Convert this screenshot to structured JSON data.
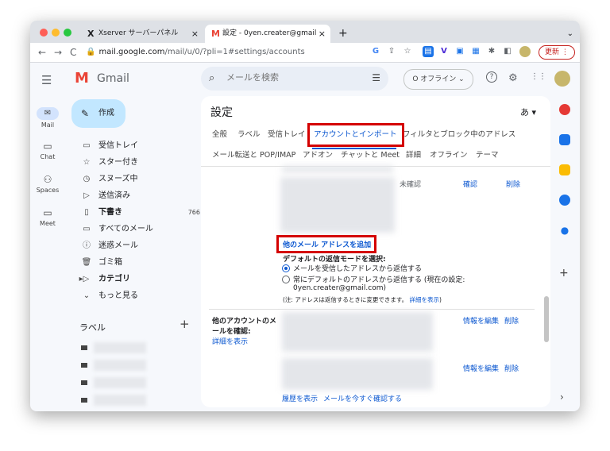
{
  "browser": {
    "tab_inactive": {
      "icon": "X",
      "title": "Xserver サーバーパネル",
      "close": "×"
    },
    "tab_active": {
      "icon": "M",
      "title": "設定 - 0yen.creater@gmail.com",
      "close": "×"
    },
    "new_tab": "+",
    "tab_menu": "⌄",
    "back": "←",
    "forward": "→",
    "reload": "C",
    "url_host": "mail.google.com",
    "url_path": "/mail/u/0/?pli=1#settings/accounts",
    "lock": "🔒",
    "update_label": "更新"
  },
  "gmail": {
    "menu_icon": "☰",
    "logo_mark": "M",
    "logo_text": "Gmail",
    "search_icon": "⌕",
    "search_placeholder": "メールを検索",
    "search_filter_icon": "☰",
    "status_label": "O オフライン ⌄",
    "help_icon": "?",
    "settings_icon": "⚙",
    "apps_icon": "⋮⋮"
  },
  "rail": [
    {
      "icon": "✉",
      "label": "Mail"
    },
    {
      "icon": "▭",
      "label": "Chat"
    },
    {
      "icon": "⚇",
      "label": "Spaces"
    },
    {
      "icon": "▭",
      "label": "Meet"
    }
  ],
  "compose": {
    "icon": "✎",
    "label": "作成"
  },
  "nav": [
    {
      "icon": "▭",
      "label": "受信トレイ",
      "count": "",
      "bold": false
    },
    {
      "icon": "☆",
      "label": "スター付き",
      "count": "",
      "bold": false
    },
    {
      "icon": "◷",
      "label": "スヌーズ中",
      "count": "",
      "bold": false
    },
    {
      "icon": "▷",
      "label": "送信済み",
      "count": "",
      "bold": false
    },
    {
      "icon": "▯",
      "label": "下書き",
      "count": "766",
      "bold": true
    },
    {
      "icon": "▭",
      "label": "すべてのメール",
      "count": "",
      "bold": false
    },
    {
      "icon": "ⓘ",
      "label": "迷惑メール",
      "count": "",
      "bold": false
    },
    {
      "icon": "🗑",
      "label": "ゴミ箱",
      "count": "",
      "bold": false
    },
    {
      "icon": "▸▷",
      "label": "カテゴリ",
      "count": "",
      "bold": true
    },
    {
      "icon": "⌄",
      "label": "もっと見る",
      "count": "",
      "bold": false
    }
  ],
  "labels": {
    "heading": "ラベル",
    "add": "+"
  },
  "settings": {
    "title": "設定",
    "lang": "あ ▾",
    "tabs_row1": [
      "全般",
      "ラベル",
      "受信トレイ",
      "アカウントとインポート",
      "フィルタとブロック中のアドレス"
    ],
    "tabs_row2": [
      "メール転送と POP/IMAP",
      "アドオン",
      "チャットと Meet",
      "詳細",
      "オフライン",
      "テーマ"
    ],
    "unconfirmed": "未確認",
    "confirm": "確認",
    "delete": "削除",
    "add_address": "他のメール アドレスを追加",
    "reply_heading": "デフォルトの返信モードを選択:",
    "reply_option1": "メールを受信したアドレスから返信する",
    "reply_option2": "常にデフォルトのアドレスから返信する (現在の設定:",
    "reply_option2_email": "0yen.creater@gmail.com)",
    "note": "(注: アドレスは返信するときに変更できます。",
    "note_link": "詳細を表示",
    "note_end": ")",
    "check_heading_1": "他のアカウントのメ",
    "check_heading_2": "ールを確認:",
    "check_details": "詳細を表示",
    "edit_info": "情報を編集",
    "history": "履歴を表示",
    "check_now": "メールを今すぐ確認する"
  },
  "colors": {
    "highlight": "#d40000",
    "link": "#0b57d0",
    "compose": "#c2e7ff"
  }
}
